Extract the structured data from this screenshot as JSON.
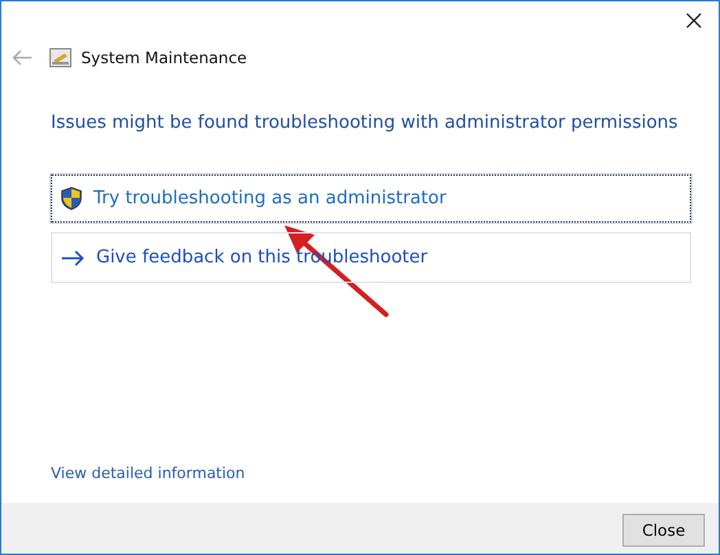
{
  "window": {
    "title": "System Maintenance"
  },
  "heading": "Issues might be found troubleshooting with administrator permissions",
  "options": [
    {
      "kind": "shield",
      "label": "Try troubleshooting as an administrator",
      "focused": true
    },
    {
      "kind": "arrow",
      "label": "Give feedback on this troubleshooter",
      "focused": false
    }
  ],
  "link": "View detailed information",
  "buttons": [
    "Close"
  ]
}
